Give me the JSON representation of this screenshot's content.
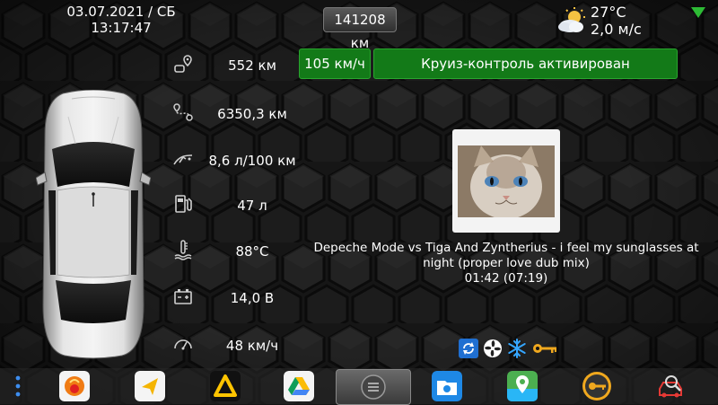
{
  "status": {
    "date": "03.07.2021 / СБ",
    "time": "13:17:47",
    "odometer": "141208 км",
    "weather": {
      "temperature": "27°C",
      "wind": "2,0 м/с"
    }
  },
  "cruise": {
    "speed": "105 км/ч",
    "message": "Круиз-контроль активирован",
    "color": "#137a18"
  },
  "stats": [
    {
      "icon": "range-icon",
      "value": "552 км"
    },
    {
      "icon": "trip-distance-icon",
      "value": "6350,3 км"
    },
    {
      "icon": "fuel-consumption-icon",
      "value": "8,6 л/100 км"
    },
    {
      "icon": "fuel-pump-icon",
      "value": "47 л"
    },
    {
      "icon": "coolant-temperature-icon",
      "value": "88°C"
    },
    {
      "icon": "battery-icon",
      "value": "14,0 В"
    },
    {
      "icon": "speedometer-icon",
      "value": "48 км/ч"
    }
  ],
  "media": {
    "track_title": "Depeche Mode vs Tiga And Zyntherius - i feel my sunglasses at night (proper love dub mix)",
    "position": "01:42 (07:19)"
  },
  "indicators": [
    "recirculation-icon",
    "fan-icon",
    "ac-snowflake-icon",
    "key-icon"
  ],
  "dock": [
    "menu-dots-icon",
    "app-orange-icon",
    "navigation-arrow-icon",
    "app-yellow-triangle-icon",
    "drive-icon",
    "home-button",
    "file-explorer-icon",
    "maps-icon",
    "key-app-icon",
    "car-diagnostics-icon"
  ]
}
